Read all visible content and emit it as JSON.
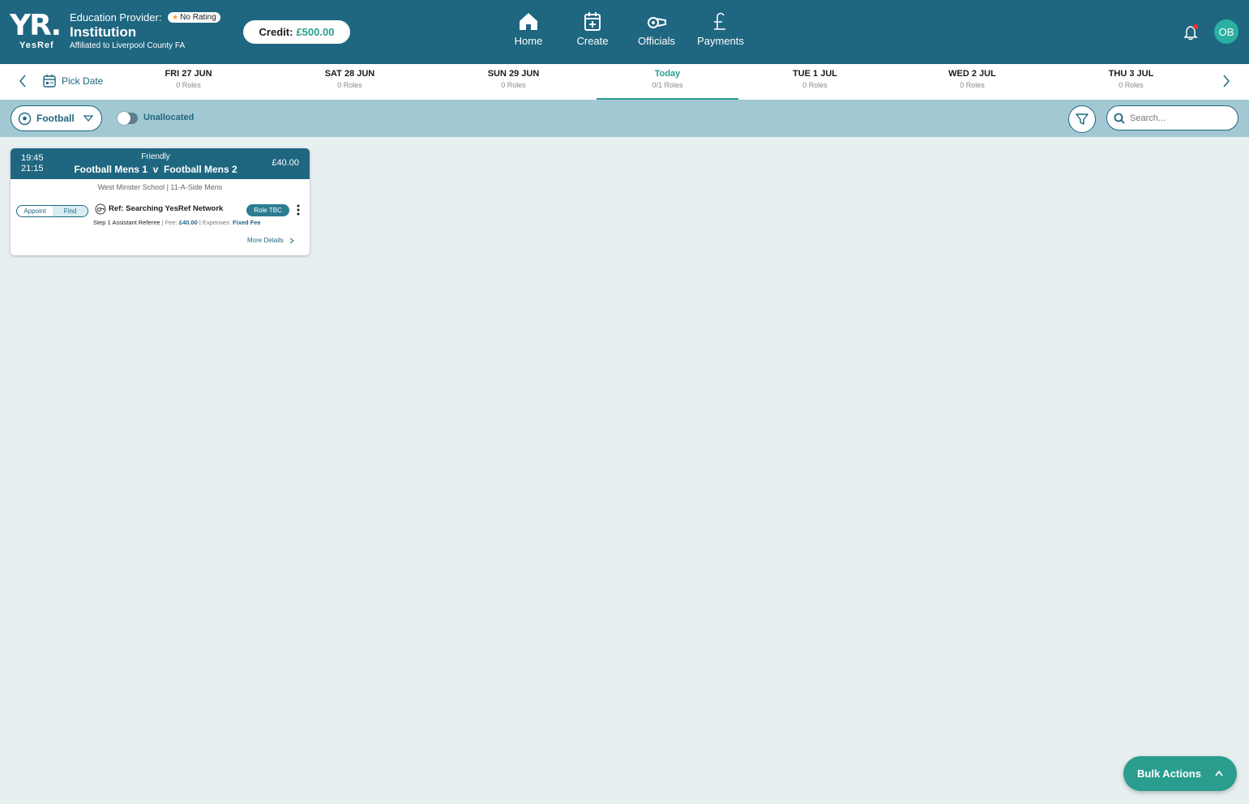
{
  "header": {
    "logo_main": "YR.",
    "logo_sub": "YesRef",
    "provider_label": "Education Provider:",
    "rating_badge": "No Rating",
    "institution": "Institution",
    "affiliation": "Affiliated to Liverpool County FA",
    "credit_label": "Credit:",
    "credit_amount": "£500.00",
    "nav": [
      {
        "label": "Home",
        "icon": "home-icon"
      },
      {
        "label": "Create",
        "icon": "calendar-plus-icon"
      },
      {
        "label": "Officials",
        "icon": "whistle-icon"
      },
      {
        "label": "Payments",
        "icon": "pound-icon"
      }
    ],
    "avatar_initials": "OB"
  },
  "datebar": {
    "pick_date_label": "Pick Date",
    "days": [
      {
        "label": "FRI 27 JUN",
        "roles": "0 Roles"
      },
      {
        "label": "SAT 28 JUN",
        "roles": "0 Roles"
      },
      {
        "label": "SUN 29 JUN",
        "roles": "0 Roles"
      },
      {
        "label": "Today",
        "roles": "0/1 Roles"
      },
      {
        "label": "TUE 1 JUL",
        "roles": "0 Roles"
      },
      {
        "label": "WED 2 JUL",
        "roles": "0 Roles"
      },
      {
        "label": "THU 3 JUL",
        "roles": "0 Roles"
      }
    ],
    "active_index": 3
  },
  "filters": {
    "sport": "Football",
    "unallocated_label": "Unallocated",
    "unallocated_on": false,
    "search_placeholder": "Search..."
  },
  "match": {
    "start_time": "19:45",
    "end_time": "21:15",
    "type": "Friendly",
    "teams": "Football Mens 1  v  Football Mens 2",
    "price": "£40.00",
    "venue": "West Minster School | 11-A-Side Mens",
    "appoint_label": "Appoint",
    "find_label": "Find",
    "ref_text": "Ref: Searching YesRef Network",
    "role_badge": "Role TBC",
    "role_name": "Step 1 Assistant Referee",
    "fee_label": "Fee:",
    "fee_value": "£40.00",
    "expenses_label": "Expenses:",
    "expenses_value": "Fixed Fee",
    "more_details": "More Details"
  },
  "bulk_actions_label": "Bulk Actions",
  "colors": {
    "header_bg": "#1f6680",
    "accent": "#2a9d8f",
    "filterbar_bg": "#a2c8d3",
    "page_bg": "#e8eff1"
  }
}
